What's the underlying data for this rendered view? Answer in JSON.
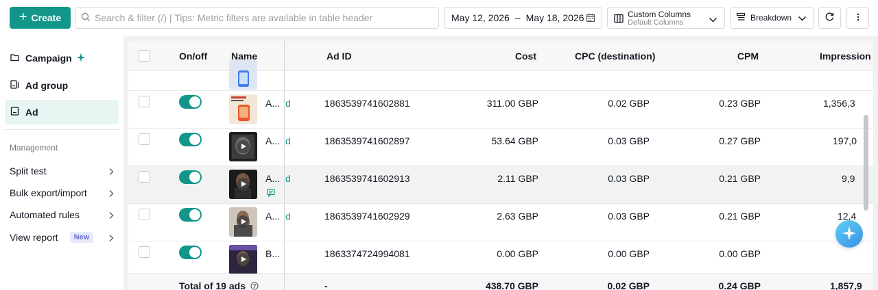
{
  "toolbar": {
    "create_label": "Create",
    "search_placeholder": "Search & filter (/) | Tips: Metric filters are available in table header",
    "date_start": "May 12, 2026",
    "date_sep": "–",
    "date_end": "May 18, 2026",
    "custom_columns_title": "Custom Columns",
    "custom_columns_sub": "Default Columns",
    "breakdown_label": "Breakdown"
  },
  "sidebar": {
    "nav": [
      {
        "label": "Campaign",
        "icon": "folder-icon"
      },
      {
        "label": "Ad group",
        "icon": "ad-group-icon"
      },
      {
        "label": "Ad",
        "icon": "ad-icon",
        "active": true
      }
    ],
    "management_title": "Management",
    "management_items": [
      {
        "label": "Split test"
      },
      {
        "label": "Bulk export/import"
      },
      {
        "label": "Automated rules"
      },
      {
        "label": "View report",
        "badge": "New"
      }
    ]
  },
  "table": {
    "headers": {
      "onoff": "On/off",
      "name": "Name",
      "ad_id": "Ad ID",
      "cost": "Cost",
      "cpc": "CPC (destination)",
      "cpm": "CPM",
      "impressions": "Impression"
    },
    "rows": [
      {
        "name": "A...",
        "partial": "d",
        "ad_id": "1863539741602881",
        "cost": "311.00 GBP",
        "cpc": "0.02 GBP",
        "cpm": "0.23 GBP",
        "impressions": "1,356,3"
      },
      {
        "name": "A...",
        "partial": "d",
        "ad_id": "1863539741602897",
        "cost": "53.64 GBP",
        "cpc": "0.03 GBP",
        "cpm": "0.27 GBP",
        "impressions": "197,0"
      },
      {
        "name": "A...",
        "partial": "d",
        "ad_id": "1863539741602913",
        "cost": "2.11 GBP",
        "cpc": "0.03 GBP",
        "cpm": "0.21 GBP",
        "impressions": "9,9"
      },
      {
        "name": "A...",
        "partial": "d",
        "ad_id": "1863539741602929",
        "cost": "2.63 GBP",
        "cpc": "0.03 GBP",
        "cpm": "0.21 GBP",
        "impressions": "12,4"
      },
      {
        "name": "B...",
        "partial": "",
        "ad_id": "1863374724994081",
        "cost": "0.00 GBP",
        "cpc": "0.00 GBP",
        "cpm": "0.00 GBP",
        "impressions": ""
      }
    ],
    "total": {
      "label": "Total of 19 ads",
      "ad_id": "-",
      "cost": "438.70 GBP",
      "cpc": "0.02 GBP",
      "cpm": "0.24 GBP",
      "impressions": "1,857,9"
    }
  },
  "colors": {
    "accent": "#12968a",
    "active_nav_bg": "#e7f5f3"
  }
}
